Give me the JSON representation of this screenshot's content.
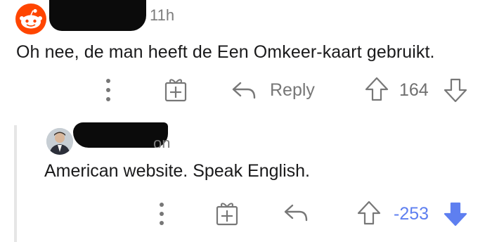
{
  "comment1": {
    "timestamp": "11h",
    "text": "Oh nee, de man heeft de Een Omkeer-kaart gebruikt.",
    "reply_label": "Reply",
    "score": "164",
    "vote_state": "none"
  },
  "comment2": {
    "username_visible_fragment": "on",
    "text": "American website. Speak English.",
    "score": "-253",
    "vote_state": "downvoted"
  },
  "colors": {
    "accent_orange": "#ff4500",
    "downvote_blue": "#5e7ff0",
    "icon_gray": "#777777"
  },
  "icons": [
    "reddit-snoo-icon",
    "more-options-icon",
    "gift-icon",
    "reply-icon",
    "upvote-icon",
    "downvote-icon"
  ]
}
